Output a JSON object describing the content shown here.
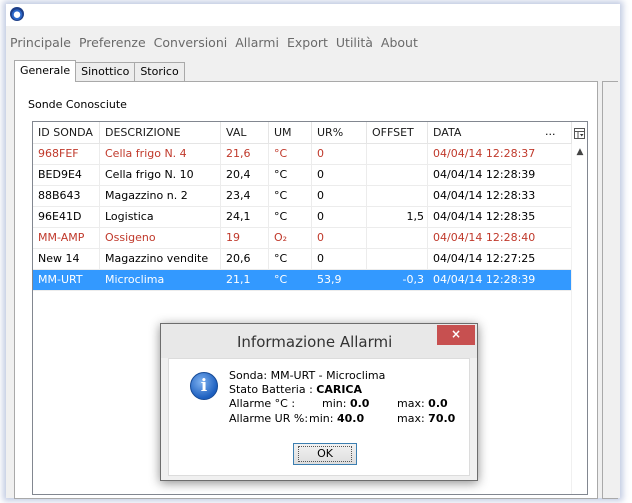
{
  "menu": [
    "Principale",
    "Preferenze",
    "Conversioni",
    "Allarmi",
    "Export",
    "Utilità",
    "About"
  ],
  "tabs": [
    {
      "label": "Generale",
      "active": true
    },
    {
      "label": "Sinottico",
      "active": false
    },
    {
      "label": "Storico",
      "active": false
    }
  ],
  "group_title": "Sonde Conosciute",
  "table": {
    "columns": [
      "ID SONDA",
      "DESCRIZIONE",
      "VAL",
      "UM",
      "UR%",
      "OFFSET",
      "DATA"
    ],
    "header_ellipsis": "...",
    "rows": [
      {
        "id": "968FEF",
        "descr": "Cella frigo N. 4",
        "val": "21,6",
        "um": "°C",
        "ur": "0",
        "offset": "",
        "data": "04/04/14 12:28:37",
        "status": "red"
      },
      {
        "id": "BED9E4",
        "descr": "Cella frigo N. 10",
        "val": "20,4",
        "um": "°C",
        "ur": "0",
        "offset": "",
        "data": "04/04/14 12:28:39",
        "status": "normal"
      },
      {
        "id": "88B643",
        "descr": "Magazzino n. 2",
        "val": "23,4",
        "um": "°C",
        "ur": "0",
        "offset": "",
        "data": "04/04/14 12:28:33",
        "status": "normal"
      },
      {
        "id": "96E41D",
        "descr": "Logistica",
        "val": "24,1",
        "um": "°C",
        "ur": "0",
        "offset": "1,5",
        "data": "04/04/14 12:28:35",
        "status": "normal"
      },
      {
        "id": "MM-AMP",
        "descr": "Ossigeno",
        "val": "19",
        "um": "O₂",
        "ur": "0",
        "offset": "",
        "data": "04/04/14 12:28:40",
        "status": "red"
      },
      {
        "id": "New 14",
        "descr": "Magazzino vendite",
        "val": "20,6",
        "um": "°C",
        "ur": "0",
        "offset": "",
        "data": "04/04/14 12:27:25",
        "status": "normal"
      },
      {
        "id": "MM-URT",
        "descr": "Microclima",
        "val": "21,1",
        "um": "°C",
        "ur": "53,9",
        "offset": "-0,3",
        "data": "04/04/14 12:28:39",
        "status": "selected"
      }
    ]
  },
  "dialog": {
    "title": "Informazione Allarmi",
    "close_glyph": "×",
    "sonda": "Sonda: MM-URT - Microclima",
    "batteria_label": "Stato Batteria :",
    "batteria_value": "CARICA",
    "allarme_c_label": "Allarme °C :",
    "allarme_c_min_label": "min:",
    "allarme_c_min": "0.0",
    "allarme_c_max_label": "max:",
    "allarme_c_max": "0.0",
    "allarme_ur_label": "Allarme UR %:",
    "allarme_ur_min_label": "min:",
    "allarme_ur_min": "40.0",
    "allarme_ur_max_label": "max:",
    "allarme_ur_max": "70.0",
    "ok_label": "OK"
  },
  "colors": {
    "alarm_red": "#c0392b",
    "selection_blue": "#3399ff",
    "close_red": "#c75050"
  }
}
